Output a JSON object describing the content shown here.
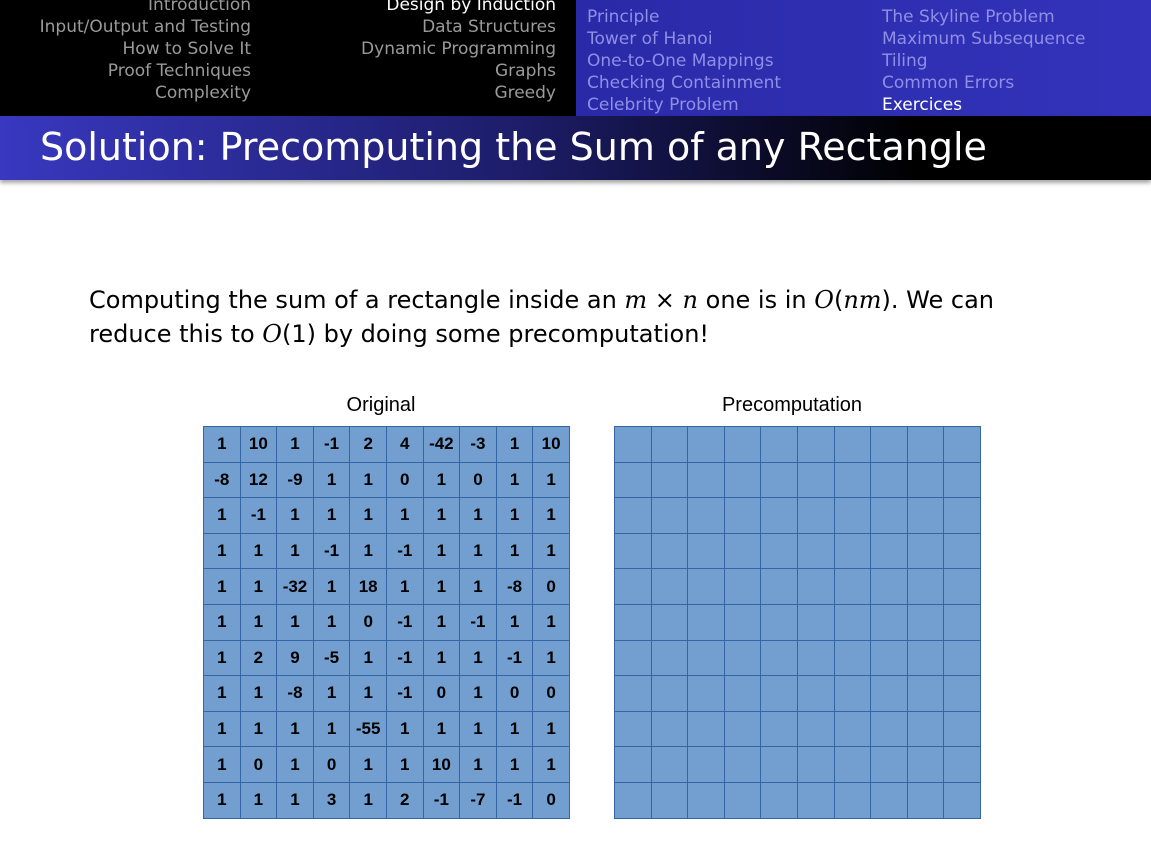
{
  "nav": {
    "sections_left": [
      "Introduction",
      "Input/Output and Testing",
      "How to Solve It",
      "Proof Techniques",
      "Complexity"
    ],
    "sections_mid": [
      "Design by Induction",
      "Data Structures",
      "Dynamic Programming",
      "Graphs",
      "Greedy"
    ],
    "sections_mid_active_index": 0,
    "subsections_left": [
      "Principle",
      "Tower of Hanoi",
      "One-to-One Mappings",
      "Checking Containment",
      "Celebrity Problem"
    ],
    "subsections_right": [
      "The Skyline Problem",
      "Maximum Subsequence",
      "Tiling",
      "Common Errors",
      "Exercices"
    ],
    "subsections_right_active_index": 4
  },
  "slide": {
    "title": "Solution: Precomputing the Sum of any Rectangle",
    "paragraph_parts": [
      "Computing the sum of a rectangle inside an ",
      "m",
      " × ",
      "n",
      " one is in ",
      "O",
      "(",
      "nm",
      "). We can reduce this to ",
      "O",
      "(1) by doing some precomputation!"
    ]
  },
  "grids": {
    "original_caption": "Original",
    "precomputation_caption": "Precomputation",
    "original": [
      [
        "1",
        "10",
        "1",
        "-1",
        "2",
        "4",
        "-42",
        "-3",
        "1",
        "10"
      ],
      [
        "-8",
        "12",
        "-9",
        "1",
        "1",
        "0",
        "1",
        "0",
        "1",
        "1"
      ],
      [
        "1",
        "-1",
        "1",
        "1",
        "1",
        "1",
        "1",
        "1",
        "1",
        "1"
      ],
      [
        "1",
        "1",
        "1",
        "-1",
        "1",
        "-1",
        "1",
        "1",
        "1",
        "1"
      ],
      [
        "1",
        "1",
        "-32",
        "1",
        "18",
        "1",
        "1",
        "1",
        "-8",
        "0"
      ],
      [
        "1",
        "1",
        "1",
        "1",
        "0",
        "-1",
        "1",
        "-1",
        "1",
        "1"
      ],
      [
        "1",
        "2",
        "9",
        "-5",
        "1",
        "-1",
        "1",
        "1",
        "-1",
        "1"
      ],
      [
        "1",
        "1",
        "-8",
        "1",
        "1",
        "-1",
        "0",
        "1",
        "0",
        "0"
      ],
      [
        "1",
        "1",
        "1",
        "1",
        "-55",
        "1",
        "1",
        "1",
        "1",
        "1"
      ],
      [
        "1",
        "0",
        "1",
        "0",
        "1",
        "1",
        "10",
        "1",
        "1",
        "1"
      ],
      [
        "1",
        "1",
        "1",
        "3",
        "1",
        "2",
        "-1",
        "-7",
        "-1",
        "0"
      ]
    ],
    "precomputation": [
      [
        "",
        "",
        "",
        "",
        "",
        "",
        "",
        "",
        "",
        ""
      ],
      [
        "",
        "",
        "",
        "",
        "",
        "",
        "",
        "",
        "",
        ""
      ],
      [
        "",
        "",
        "",
        "",
        "",
        "",
        "",
        "",
        "",
        ""
      ],
      [
        "",
        "",
        "",
        "",
        "",
        "",
        "",
        "",
        "",
        ""
      ],
      [
        "",
        "",
        "",
        "",
        "",
        "",
        "",
        "",
        "",
        ""
      ],
      [
        "",
        "",
        "",
        "",
        "",
        "",
        "",
        "",
        "",
        ""
      ],
      [
        "",
        "",
        "",
        "",
        "",
        "",
        "",
        "",
        "",
        ""
      ],
      [
        "",
        "",
        "",
        "",
        "",
        "",
        "",
        "",
        "",
        ""
      ],
      [
        "",
        "",
        "",
        "",
        "",
        "",
        "",
        "",
        "",
        ""
      ],
      [
        "",
        "",
        "",
        "",
        "",
        "",
        "",
        "",
        "",
        ""
      ],
      [
        "",
        "",
        "",
        "",
        "",
        "",
        "",
        "",
        "",
        ""
      ]
    ]
  },
  "colors": {
    "nav_black": "#000000",
    "nav_blue": "#3333bb",
    "nav_inactive": "#9a9a9a",
    "nav_blue_inactive": "#8f8fe6",
    "cell_fill": "#729fcf",
    "cell_border": "#3465a4"
  }
}
